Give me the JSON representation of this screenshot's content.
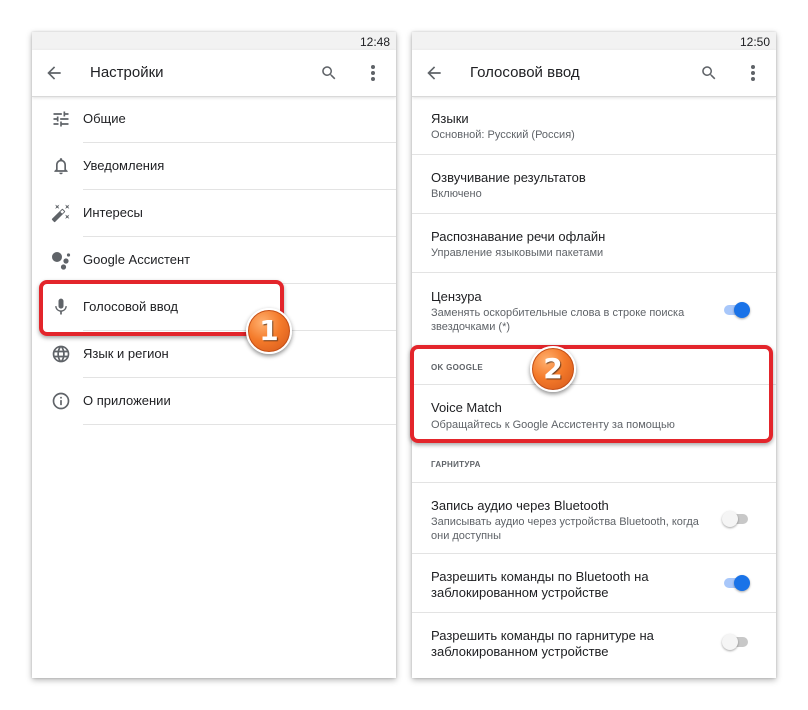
{
  "left": {
    "time": "12:48",
    "title": "Настройки",
    "items": [
      {
        "label": "Общие",
        "icon": "tune-icon"
      },
      {
        "label": "Уведомления",
        "icon": "bell-icon"
      },
      {
        "label": "Интересы",
        "icon": "magic-wand-icon"
      },
      {
        "label": "Google Ассистент",
        "icon": "assistant-icon"
      },
      {
        "label": "Голосовой ввод",
        "icon": "microphone-icon"
      },
      {
        "label": "Язык и регион",
        "icon": "globe-icon"
      },
      {
        "label": "О приложении",
        "icon": "info-icon"
      }
    ],
    "badge": "1"
  },
  "right": {
    "time": "12:50",
    "title": "Голосовой ввод",
    "prefs": [
      {
        "title": "Языки",
        "subtitle": "Основной: Русский (Россия)"
      },
      {
        "title": "Озвучивание результатов",
        "subtitle": "Включено"
      },
      {
        "title": "Распознавание речи офлайн",
        "subtitle": "Управление языковыми пакетами"
      },
      {
        "title": "Цензура",
        "subtitle": "Заменять оскорбительные слова в строке поиска звездочками (*)",
        "toggle": true
      }
    ],
    "section_ok_google": "OK GOOGLE",
    "voice_match": {
      "title": "Voice Match",
      "subtitle": "Обращайтесь к Google Ассистенту за помощью"
    },
    "section_headset": "ГАРНИТУРА",
    "headset_prefs": [
      {
        "title": "Запись аудио через Bluetooth",
        "subtitle": "Записывать аудио через устройства Bluetooth, когда они доступны",
        "toggle": false
      },
      {
        "title": "Разрешить команды по Bluetooth на заблокированном устройстве",
        "toggle": true
      },
      {
        "title": "Разрешить команды по гарнитуре на заблокированном устройстве",
        "toggle": false
      }
    ],
    "badge": "2"
  },
  "colors": {
    "accent": "#1a73e8",
    "highlight": "#e3252b",
    "badge": "#f47a2a"
  }
}
